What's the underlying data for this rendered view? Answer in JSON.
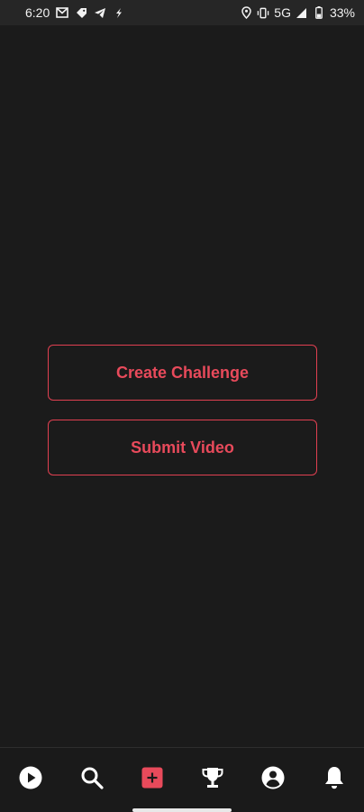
{
  "status_bar": {
    "time": "6:20",
    "network": "5G",
    "battery": "33%",
    "left_icons": [
      "gmail-icon",
      "tag-icon",
      "telegram-icon",
      "bolt-icon"
    ],
    "right_icons": [
      "location-icon",
      "vibrate-icon",
      "signal-icon",
      "battery-icon"
    ]
  },
  "actions": {
    "create_challenge_label": "Create Challenge",
    "submit_video_label": "Submit Video"
  },
  "bottom_nav": {
    "items": [
      "play-icon",
      "search-icon",
      "add-icon",
      "trophy-icon",
      "profile-icon",
      "notifications-icon"
    ]
  },
  "colors": {
    "background": "#1b1b1b",
    "accent": "#e84a5b",
    "status_bar": "#262626",
    "nav_icon": "#ffffff"
  }
}
